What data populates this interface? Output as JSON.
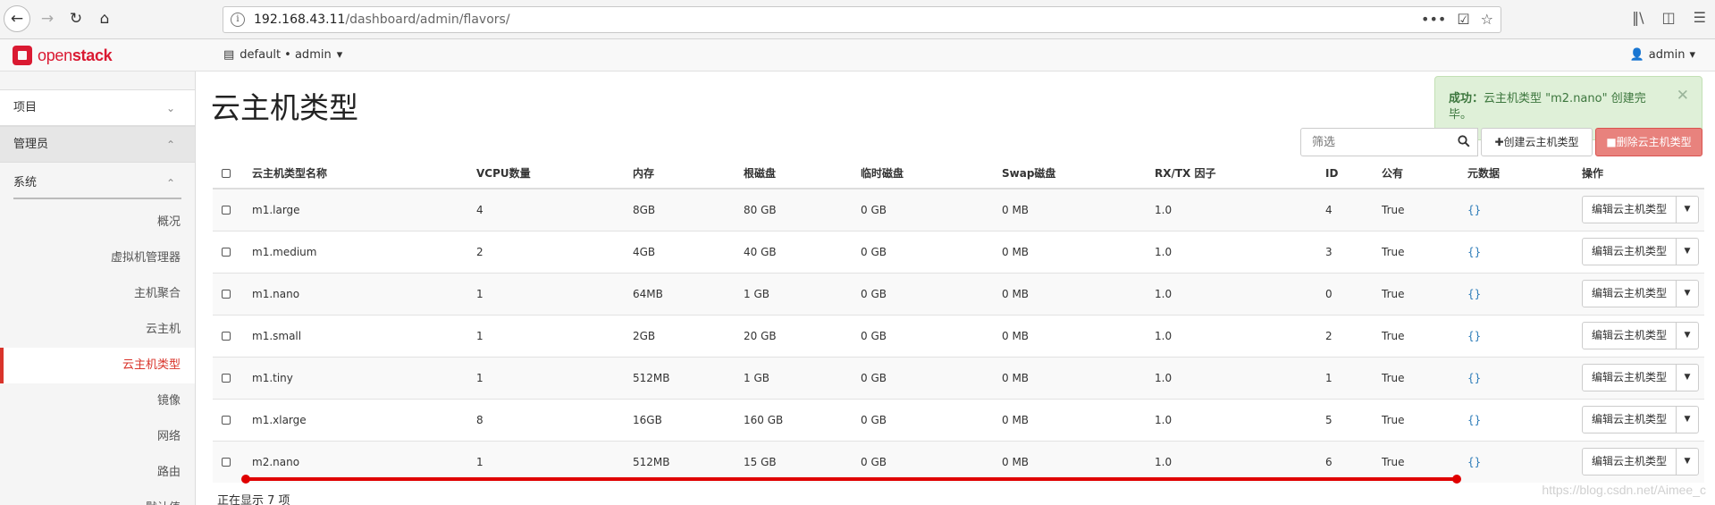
{
  "browser": {
    "url_host": "192.168.43.11",
    "url_path": "/dashboard/admin/flavors/",
    "more_glyph": "•••"
  },
  "header": {
    "logo_text_1": "open",
    "logo_text_2": "stack",
    "project_label": "default • admin",
    "user_label": "admin"
  },
  "sidebar": {
    "sections": [
      {
        "label": "项目"
      },
      {
        "label": "管理员"
      }
    ],
    "subsection": "系统",
    "items": [
      {
        "label": "概况"
      },
      {
        "label": "虚拟机管理器"
      },
      {
        "label": "主机聚合"
      },
      {
        "label": "云主机"
      },
      {
        "label": "云主机类型"
      },
      {
        "label": "镜像"
      },
      {
        "label": "网络"
      },
      {
        "label": "路由"
      },
      {
        "label": "默认值"
      }
    ]
  },
  "page": {
    "title": "云主机类型",
    "filter_placeholder": "筛选",
    "create_button": "创建云主机类型",
    "delete_button": "删除云主机类型",
    "footer_count": "正在显示 7 项"
  },
  "toast": {
    "title": "成功：",
    "message": "云主机类型 \"m2.nano\" 创建完毕。"
  },
  "table": {
    "headers": [
      "云主机类型名称",
      "VCPU数量",
      "内存",
      "根磁盘",
      "临时磁盘",
      "Swap磁盘",
      "RX/TX 因子",
      "ID",
      "公有",
      "元数据",
      "操作"
    ],
    "rows": [
      {
        "name": "m1.large",
        "vcpu": "4",
        "ram": "8GB",
        "root": "80 GB",
        "ephemeral": "0 GB",
        "swap": "0 MB",
        "rxtx": "1.0",
        "id": "4",
        "public": "True",
        "meta": "{}",
        "action": "编辑云主机类型"
      },
      {
        "name": "m1.medium",
        "vcpu": "2",
        "ram": "4GB",
        "root": "40 GB",
        "ephemeral": "0 GB",
        "swap": "0 MB",
        "rxtx": "1.0",
        "id": "3",
        "public": "True",
        "meta": "{}",
        "action": "编辑云主机类型"
      },
      {
        "name": "m1.nano",
        "vcpu": "1",
        "ram": "64MB",
        "root": "1 GB",
        "ephemeral": "0 GB",
        "swap": "0 MB",
        "rxtx": "1.0",
        "id": "0",
        "public": "True",
        "meta": "{}",
        "action": "编辑云主机类型"
      },
      {
        "name": "m1.small",
        "vcpu": "1",
        "ram": "2GB",
        "root": "20 GB",
        "ephemeral": "0 GB",
        "swap": "0 MB",
        "rxtx": "1.0",
        "id": "2",
        "public": "True",
        "meta": "{}",
        "action": "编辑云主机类型"
      },
      {
        "name": "m1.tiny",
        "vcpu": "1",
        "ram": "512MB",
        "root": "1 GB",
        "ephemeral": "0 GB",
        "swap": "0 MB",
        "rxtx": "1.0",
        "id": "1",
        "public": "True",
        "meta": "{}",
        "action": "编辑云主机类型"
      },
      {
        "name": "m1.xlarge",
        "vcpu": "8",
        "ram": "16GB",
        "root": "160 GB",
        "ephemeral": "0 GB",
        "swap": "0 MB",
        "rxtx": "1.0",
        "id": "5",
        "public": "True",
        "meta": "{}",
        "action": "编辑云主机类型"
      },
      {
        "name": "m2.nano",
        "vcpu": "1",
        "ram": "512MB",
        "root": "15 GB",
        "ephemeral": "0 GB",
        "swap": "0 MB",
        "rxtx": "1.0",
        "id": "6",
        "public": "True",
        "meta": "{}",
        "action": "编辑云主机类型"
      }
    ]
  },
  "watermark": "https://blog.csdn.net/Aimee_c",
  "colors": {
    "brand": "#da1a32",
    "active_nav": "#d9342b",
    "success_bg": "#dff0d8",
    "danger": "#d9534f",
    "annotation_red": "#e00000"
  }
}
